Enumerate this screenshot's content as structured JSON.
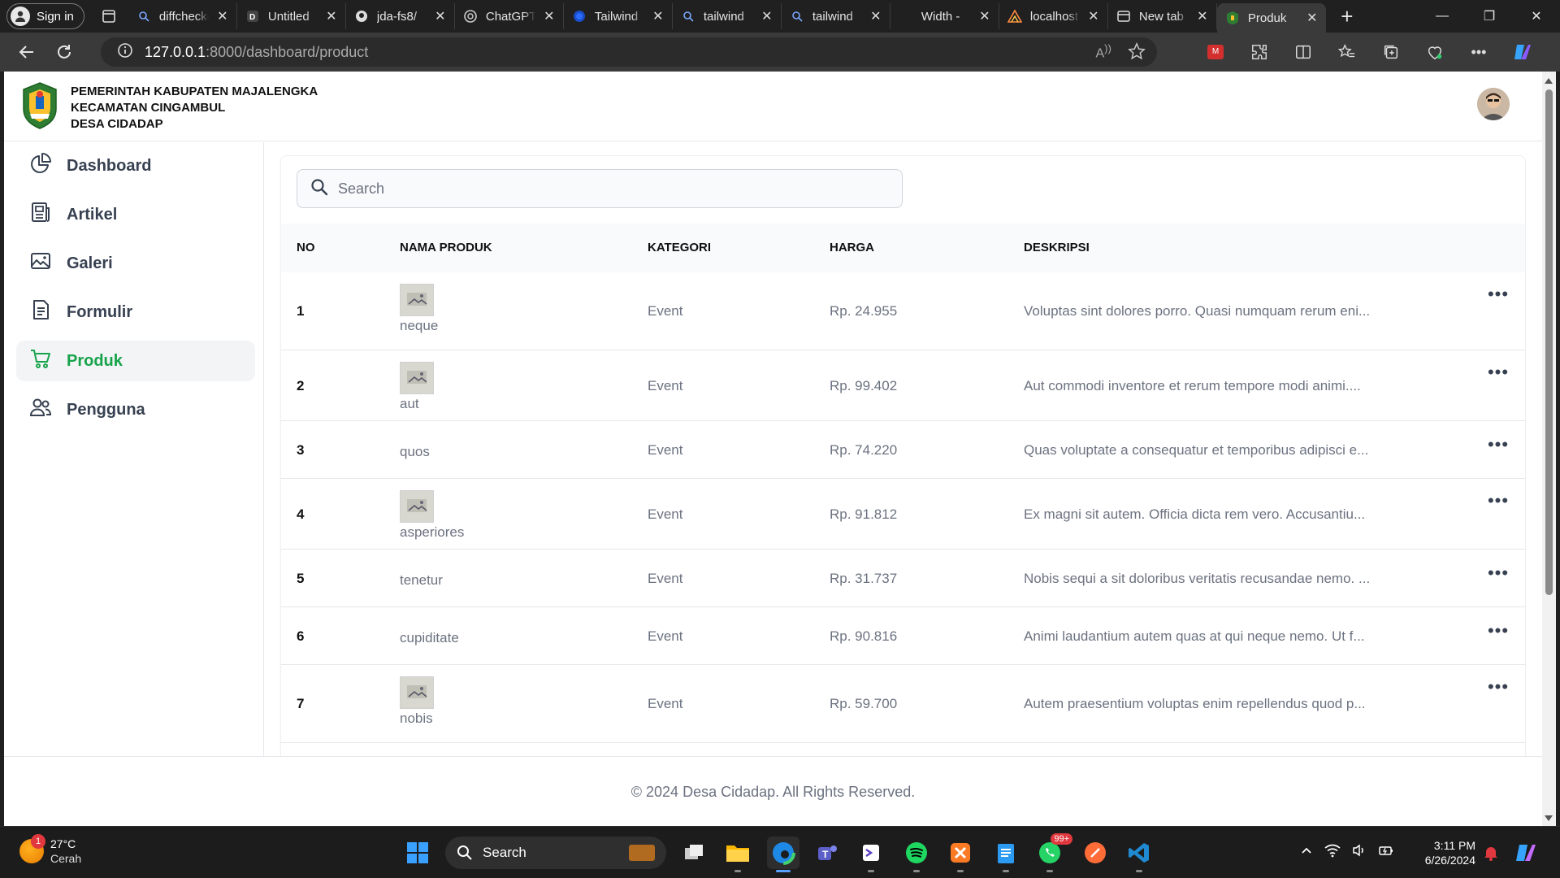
{
  "browser": {
    "profile_label": "Sign in",
    "tabs": [
      {
        "title": "diffchecker",
        "fav": "search"
      },
      {
        "title": "Untitled",
        "fav": "doc"
      },
      {
        "title": "jda-fs8/",
        "fav": "github"
      },
      {
        "title": "ChatGPT",
        "fav": "chatgpt"
      },
      {
        "title": "Tailwind",
        "fav": "circle"
      },
      {
        "title": "tailwind",
        "fav": "search"
      },
      {
        "title": "tailwind",
        "fav": "search"
      },
      {
        "title": "Width -",
        "fav": "tailwind"
      },
      {
        "title": "localhost",
        "fav": "laravel"
      },
      {
        "title": "New tab",
        "fav": "newtab"
      },
      {
        "title": "Produk",
        "fav": "logo",
        "active": true
      }
    ],
    "url_host": "127.0.0.1",
    "url_path": ":8000/dashboard/product"
  },
  "header": {
    "line1": "PEMERINTAH KABUPATEN MAJALENGKA",
    "line2": "KECAMATAN CINGAMBUL",
    "line3": "DESA CIDADAP"
  },
  "sidebar": {
    "items": [
      {
        "label": "Dashboard",
        "icon": "chart-pie-icon"
      },
      {
        "label": "Artikel",
        "icon": "newspaper-icon"
      },
      {
        "label": "Galeri",
        "icon": "image-icon"
      },
      {
        "label": "Formulir",
        "icon": "document-icon"
      },
      {
        "label": "Produk",
        "icon": "cart-icon",
        "active": true
      },
      {
        "label": "Pengguna",
        "icon": "users-icon"
      }
    ]
  },
  "search": {
    "placeholder": "Search"
  },
  "table": {
    "headers": [
      "NO",
      "NAMA PRODUK",
      "KATEGORI",
      "HARGA",
      "DESKRIPSI"
    ],
    "more_label": "•••",
    "rows": [
      {
        "no": "1",
        "name": "neque",
        "img": true,
        "kategori": "Event",
        "harga": "Rp. 24.955",
        "deskripsi": "Voluptas sint dolores porro. Quasi numquam rerum eni..."
      },
      {
        "no": "2",
        "name": "aut",
        "img": true,
        "kategori": "Event",
        "harga": "Rp. 99.402",
        "deskripsi": "Aut commodi inventore et rerum tempore modi animi...."
      },
      {
        "no": "3",
        "name": "quos",
        "img": false,
        "kategori": "Event",
        "harga": "Rp. 74.220",
        "deskripsi": "Quas voluptate a consequatur et temporibus adipisci e..."
      },
      {
        "no": "4",
        "name": "asperiores",
        "img": true,
        "kategori": "Event",
        "harga": "Rp. 91.812",
        "deskripsi": "Ex magni sit autem. Officia dicta rem vero. Accusantiu..."
      },
      {
        "no": "5",
        "name": "tenetur",
        "img": false,
        "kategori": "Event",
        "harga": "Rp. 31.737",
        "deskripsi": "Nobis sequi a sit doloribus veritatis recusandae nemo. ..."
      },
      {
        "no": "6",
        "name": "cupiditate",
        "img": false,
        "kategori": "Event",
        "harga": "Rp. 90.816",
        "deskripsi": "Animi laudantium autem quas at qui neque nemo. Ut f..."
      },
      {
        "no": "7",
        "name": "nobis",
        "img": true,
        "kategori": "Event",
        "harga": "Rp. 59.700",
        "deskripsi": "Autem praesentium voluptas enim repellendus quod p..."
      }
    ]
  },
  "footer": {
    "text": "© 2024 Desa Cidadap. All Rights Reserved."
  },
  "taskbar": {
    "weather_temp": "27°C",
    "weather_desc": "Cerah",
    "weather_badge": "1",
    "search_label": "Search",
    "whatsapp_badge": "99+",
    "time": "3:11 PM",
    "date": "6/26/2024"
  },
  "colors": {
    "accent": "#16a34a",
    "text": "#111111",
    "muted": "#6b7280"
  }
}
